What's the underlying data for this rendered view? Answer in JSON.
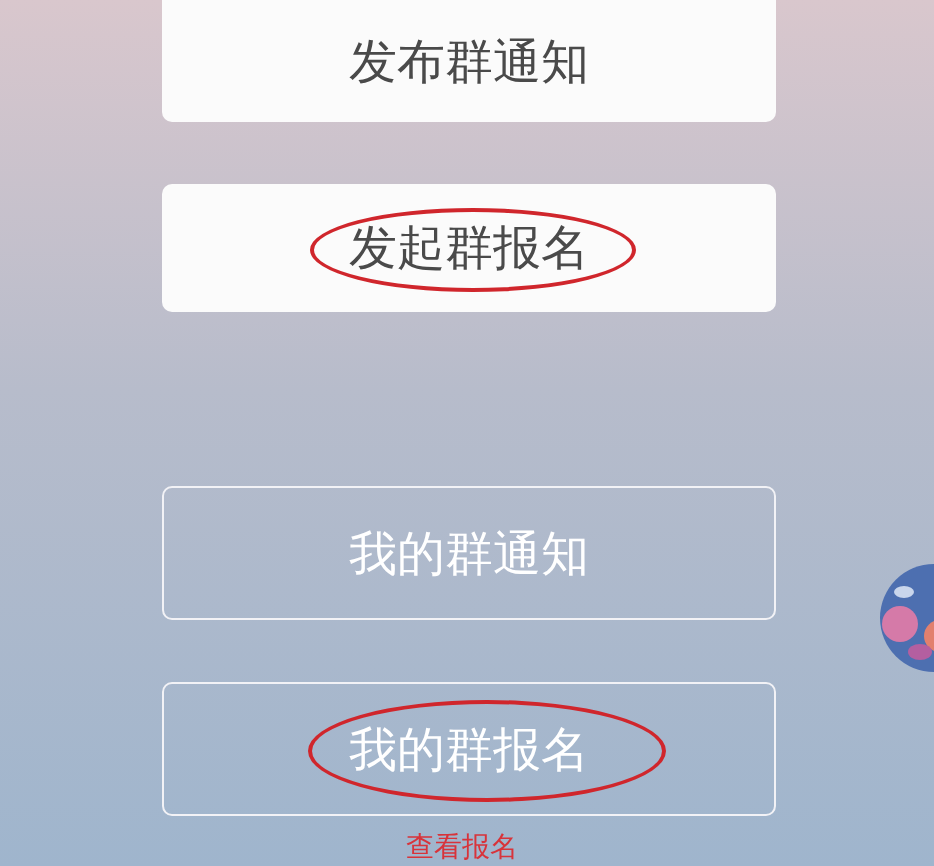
{
  "sections": [
    {
      "buttons": [
        {
          "label": "发布群通知",
          "kind": "filled",
          "circled": false
        },
        {
          "label": "发起群报名",
          "kind": "filled",
          "circled": true
        }
      ]
    },
    {
      "buttons": [
        {
          "label": "我的群通知",
          "kind": "outline",
          "circled": false
        },
        {
          "label": "我的群报名",
          "kind": "outline",
          "circled": true
        }
      ]
    }
  ],
  "link": "查看报名"
}
